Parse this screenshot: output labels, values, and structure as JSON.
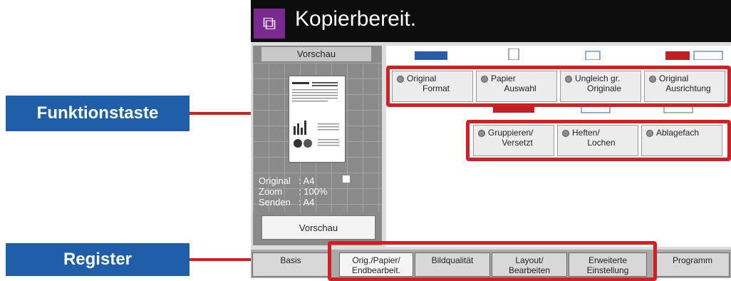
{
  "callouts": {
    "funktionstaste": "Funktionstaste",
    "register": "Register"
  },
  "title": {
    "text": "Kopierbereit.",
    "icon": "copy-icon"
  },
  "preview": {
    "header": "Vorschau",
    "original_label": "Original",
    "original_value": ": A4",
    "zoom_label": "Zoom",
    "zoom_value": ": 100%",
    "senden_label": "Senden",
    "senden_value": ": A4",
    "button": "Vorschau"
  },
  "function_keys": {
    "original_format": {
      "line1": "Original",
      "line2": "Format"
    },
    "papier_auswahl": {
      "line1": "Papier",
      "line2": "Auswahl"
    },
    "ungleich": {
      "line1": "Ungleich gr.",
      "line2": "Originale"
    },
    "ausrichtung": {
      "line1": "Original",
      "line2": "Ausrichtung"
    },
    "gruppieren": {
      "line1": "Gruppieren/",
      "line2": "Versetzt"
    },
    "heften": {
      "line1": "Heften/",
      "line2": "Lochen"
    },
    "ablagefach": {
      "line1": "Ablagefach",
      "line2": ""
    }
  },
  "tabs": {
    "basis": "Basis",
    "orig": {
      "line1": "Orig./Papier/",
      "line2": "Endbearbeit."
    },
    "bildqualitaet": "Bildqualität",
    "layout": {
      "line1": "Layout/",
      "line2": "Bearbeiten"
    },
    "erweiterte": {
      "line1": "Erweiterte",
      "line2": "Einstellung"
    },
    "programm": "Programm"
  },
  "colors": {
    "accent_red": "#d11f26",
    "callout_blue": "#1f5fa8",
    "title_bg": "#0d0d0d",
    "app_icon": "#7a2a8f"
  }
}
